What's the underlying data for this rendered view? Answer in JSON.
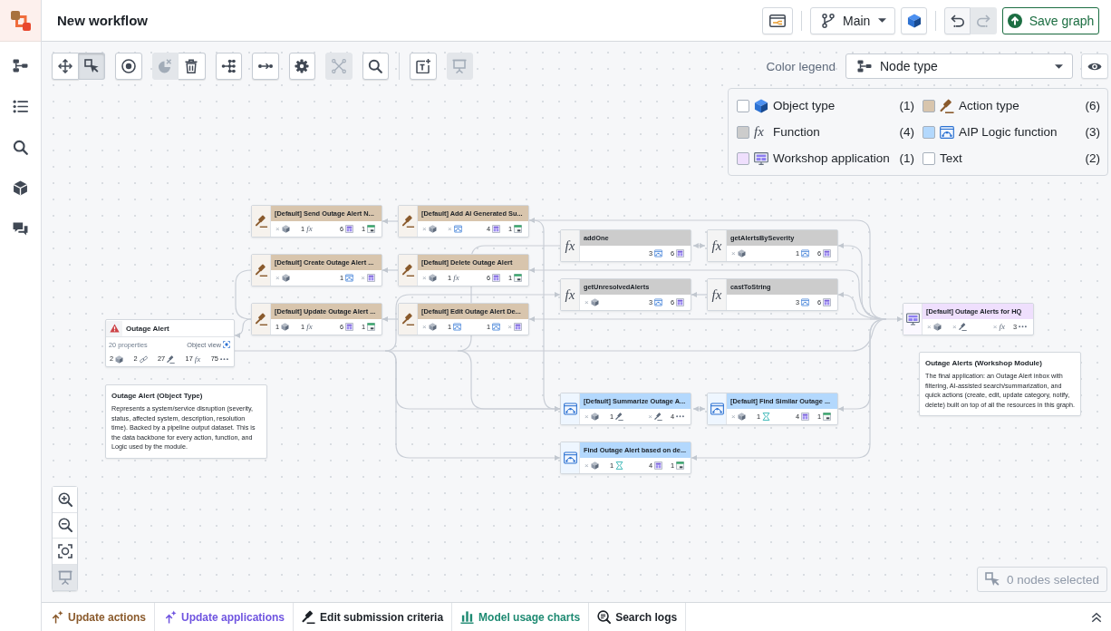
{
  "header": {
    "title": "New workflow",
    "branch": "Main",
    "history": [
      {
        "disabled": false
      },
      {
        "disabled": true
      }
    ],
    "save_label": "Save graph"
  },
  "toolbar": {
    "modes": [
      {
        "selected": false
      },
      {
        "selected": true
      }
    ],
    "actions": [
      {
        "disabled": false
      },
      {
        "disabled": true
      },
      {
        "disabled": false
      },
      {
        "disabled": false
      },
      {
        "disabled": false
      },
      {
        "disabled": false
      },
      {
        "disabled": true
      },
      {
        "disabled": false
      },
      {
        "disabled": false
      },
      {
        "disabled": true
      }
    ]
  },
  "color_legend": {
    "label": "Color legend",
    "value": "Node type",
    "items": [
      {
        "kind": "object",
        "label": "Object type",
        "count": "(1)",
        "color": "#ffffff"
      },
      {
        "kind": "action",
        "label": "Action type",
        "count": "(6)",
        "color": "#d8c5ad"
      },
      {
        "kind": "function",
        "glyph": "fx",
        "label": "Function",
        "count": "(4)",
        "color": "#cccccc"
      },
      {
        "kind": "logic",
        "label": "AIP Logic function",
        "count": "(3)",
        "color": "#b3d8fd"
      },
      {
        "kind": "workshop",
        "label": "Workshop application",
        "count": "(1)",
        "color": "#efdffd"
      },
      {
        "kind": "text",
        "label": "Text",
        "count": "(2)",
        "color": "#ffffff"
      }
    ]
  },
  "graph": {
    "nodes": [
      {
        "kind": "action",
        "title": "[Default] Send Outage Alert N...",
        "stats": [
          {
            "kind": "object",
            "count": "×",
            "empty": true
          },
          {
            "kind": "function",
            "glyph": "fx",
            "count": "1",
            "empty": false
          },
          {
            "kind": "workshop",
            "count": "6",
            "empty": false
          },
          {
            "kind": "app",
            "count": "1",
            "empty": false
          }
        ]
      },
      {
        "kind": "action",
        "title": "[Default] Add AI Generated Su...",
        "stats": [
          {
            "kind": "object",
            "count": "×",
            "empty": true
          },
          {
            "kind": "logic",
            "count": "×",
            "empty": true
          },
          {
            "kind": "workshop",
            "count": "4",
            "empty": false
          },
          {
            "kind": "app",
            "count": "1",
            "empty": false
          }
        ]
      },
      {
        "kind": "function",
        "glyph": "fx",
        "title": "addOne",
        "stats": [
          {
            "kind": "logic",
            "count": "3",
            "empty": false
          },
          {
            "kind": "workshop",
            "count": "6",
            "empty": false
          }
        ]
      },
      {
        "kind": "function",
        "glyph": "fx",
        "title": "getAlertsBySeverity",
        "stats": [
          {
            "kind": "object",
            "count": "×",
            "empty": true
          },
          {
            "kind": "logic",
            "count": "1",
            "empty": false
          },
          {
            "kind": "workshop",
            "count": "6",
            "empty": false
          }
        ]
      },
      {
        "kind": "action",
        "title": "[Default] Create Outage Alert ...",
        "stats": [
          {
            "kind": "object",
            "count": "×",
            "empty": true
          },
          {
            "kind": "logic",
            "count": "1",
            "empty": false
          },
          {
            "kind": "workshop",
            "count": "×",
            "empty": true
          }
        ]
      },
      {
        "kind": "action",
        "title": "[Default] Delete Outage Alert",
        "stats": [
          {
            "kind": "object",
            "count": "×",
            "empty": true
          },
          {
            "kind": "function",
            "glyph": "fx",
            "count": "1",
            "empty": false
          },
          {
            "kind": "workshop",
            "count": "6",
            "empty": false
          },
          {
            "kind": "app",
            "count": "1",
            "empty": false
          }
        ]
      },
      {
        "kind": "function",
        "glyph": "fx",
        "title": "getUnresolvedAlerts",
        "stats": [
          {
            "kind": "object",
            "count": "×",
            "empty": true
          },
          {
            "kind": "logic",
            "count": "3",
            "empty": false
          },
          {
            "kind": "workshop",
            "count": "6",
            "empty": false
          }
        ]
      },
      {
        "kind": "function",
        "glyph": "fx",
        "title": "castToString",
        "stats": [
          {
            "kind": "logic",
            "count": "3",
            "empty": false
          },
          {
            "kind": "workshop",
            "count": "6",
            "empty": false
          }
        ]
      },
      {
        "kind": "action",
        "title": "[Default] Update Outage Alert ...",
        "stats": [
          {
            "kind": "object",
            "count": "1",
            "empty": false
          },
          {
            "kind": "function",
            "glyph": "fx",
            "count": "1",
            "empty": false
          },
          {
            "kind": "workshop",
            "count": "6",
            "empty": false
          },
          {
            "kind": "app",
            "count": "1",
            "empty": false
          }
        ]
      },
      {
        "kind": "action",
        "title": "[Default] Edit Outage Alert De...",
        "stats": [
          {
            "kind": "object",
            "count": "×",
            "empty": true
          },
          {
            "kind": "logic",
            "count": "1",
            "empty": false
          },
          {
            "kind": "logic",
            "count": "1",
            "empty": false
          },
          {
            "kind": "workshop",
            "count": "×",
            "empty": true
          }
        ]
      },
      {
        "kind": "workshop",
        "title": "[Default] Outage Alerts for HQ",
        "stats": [
          {
            "kind": "object",
            "count": "×",
            "empty": true
          },
          {
            "kind": "action",
            "count": "×",
            "empty": true
          },
          {
            "kind": "function",
            "glyph": "fx",
            "count": "×",
            "empty": true
          },
          {
            "kind": "more",
            "count": "3",
            "empty": false
          }
        ]
      },
      {
        "kind": "object",
        "title": "Outage Alert",
        "properties": "20 properties",
        "view_label": "Object view",
        "stats": [
          {
            "kind": "object",
            "count": "2"
          },
          {
            "kind": "link",
            "count": "2"
          },
          {
            "kind": "action",
            "count": "27"
          },
          {
            "kind": "function",
            "glyph": "fx",
            "count": "17"
          },
          {
            "kind": "more",
            "count": "75"
          }
        ]
      },
      {
        "kind": "text",
        "title": "Outage Alerts (Workshop Module)",
        "body": "The final application: an Outage Alert inbox with filtering, AI-assisted search/summarization, and quick actions (create, edit, update category, notify, delete) built on top of all the resources in this graph."
      },
      {
        "kind": "text",
        "title": "Outage Alert (Object Type)",
        "body": "Represents a system/service disruption (severity, status, affected system, description, resolution time). Backed by a pipeline output dataset. This is the data backbone for every action, function, and Logic used by the module."
      },
      {
        "kind": "logic",
        "title": "[Default] Summarize Outage A...",
        "stats": [
          {
            "kind": "object",
            "count": "×",
            "empty": true
          },
          {
            "kind": "action",
            "count": "1",
            "empty": false
          },
          {
            "kind": "action",
            "count": "×",
            "empty": true
          },
          {
            "kind": "more",
            "count": "4",
            "empty": false
          }
        ]
      },
      {
        "kind": "logic",
        "title": "[Default] Find Similar Outage ...",
        "stats": [
          {
            "kind": "object",
            "count": "×",
            "empty": true
          },
          {
            "kind": "embedding",
            "count": "1",
            "empty": false
          },
          {
            "kind": "workshop",
            "count": "4",
            "empty": false
          },
          {
            "kind": "app",
            "count": "1",
            "empty": false
          }
        ]
      },
      {
        "kind": "logic",
        "title": "Find Outage Alert based on de...",
        "stats": [
          {
            "kind": "object",
            "count": "×",
            "empty": true
          },
          {
            "kind": "embedding",
            "count": "1",
            "empty": false
          },
          {
            "kind": "workshop",
            "count": "4",
            "empty": false
          },
          {
            "kind": "app",
            "count": "1",
            "empty": false
          }
        ]
      }
    ]
  },
  "zoom_controls": [
    {
      "disabled": false
    },
    {
      "disabled": false
    },
    {
      "disabled": false
    },
    {
      "disabled": true
    }
  ],
  "selection_status": "0 nodes selected",
  "bottom_tabs": [
    {
      "label": "Update actions",
      "color": "#8a5a2c"
    },
    {
      "label": "Update applications",
      "color": "#6f54e0"
    },
    {
      "label": "Edit submission criteria",
      "color": "#1c2127"
    },
    {
      "label": "Model usage charts",
      "color": "#1e8a72"
    },
    {
      "label": "Search logs",
      "color": "#1c2127"
    }
  ]
}
